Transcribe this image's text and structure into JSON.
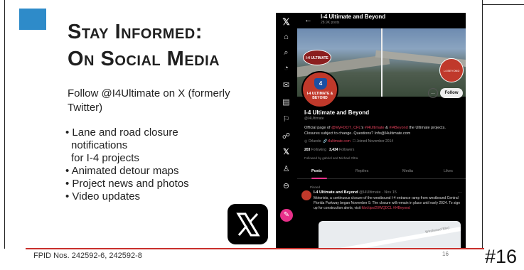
{
  "slide": {
    "title_line1": "Stay Informed:",
    "title_line2": "On Social Media",
    "follow_text": "Follow @I4Ultimate on X (formerly Twitter)",
    "bullets": [
      "• Lane and road closure",
      "  notifications",
      "  for I-4 projects",
      "• Animated detour maps",
      "• Project news and photos",
      "• Video updates"
    ],
    "footer_left": "FPID Nos. 242592-6, 242592-8",
    "footer_page": "16",
    "big_number": "#16"
  },
  "colors": {
    "accent_blue": "#2e8bc9",
    "footer_red": "#c9302c",
    "x_pink": "#e8308a"
  },
  "x_profile": {
    "header_name": "I-4 Ultimate and Beyond",
    "header_posts": "28.9K posts",
    "banner_logo_text": "I-4 ULTIMATE",
    "banner_logo2_text": "I-4 BEYOND",
    "avatar_shield": "4",
    "avatar_text": "I-4 ULTIMATE & BEYOND",
    "more_icon": "...",
    "follow_label": "Follow",
    "display_name": "I-4 Ultimate and Beyond",
    "handle": "@I4Ultimate",
    "bio_a": "Official page of ",
    "bio_link1": "@MyFDOT_CFL",
    "bio_b": "'s ",
    "bio_link2": "#I4Ultimate",
    "bio_c": " & ",
    "bio_link3": "#I4Beyond",
    "bio_d": " the Ultimate projects. Closures subject to change. Questions? Info@I4ultimate.com",
    "location": "◎ Orlando",
    "website": "i4ultimate.com",
    "joined": "☐ Joined November 2014",
    "following_count": "203",
    "following_label": "Following",
    "followers_count": "3,434",
    "followers_label": "Followers",
    "followed_by": "Followed by gabriel and Michael Oltra",
    "tabs": [
      "Posts",
      "Replies",
      "Media",
      "Likes"
    ],
    "pinned_label": "Pinned",
    "post_author": "I-4 Ultimate and Beyond",
    "post_sub": " @I4Ultimate · Nov 15",
    "post_more": "···",
    "post_body": "Motorists, a continuous closure of the westbound I-4 entrance ramp from westbound Central Florida Parkway began November 9. The closure will remain in place until early 2024. To sign up for construction alerts, visit ",
    "post_link": "fdot.tips/20WQDCL #I4Beyond",
    "map_label": "Westwood Blvd",
    "rail_icons": [
      "x-logo-icon",
      "home-icon",
      "search-icon",
      "notifications-icon",
      "messages-icon",
      "lists-icon",
      "bookmarks-icon",
      "communities-icon",
      "premium-icon",
      "profile-icon",
      "more-icon"
    ],
    "post_fab": "✎"
  }
}
